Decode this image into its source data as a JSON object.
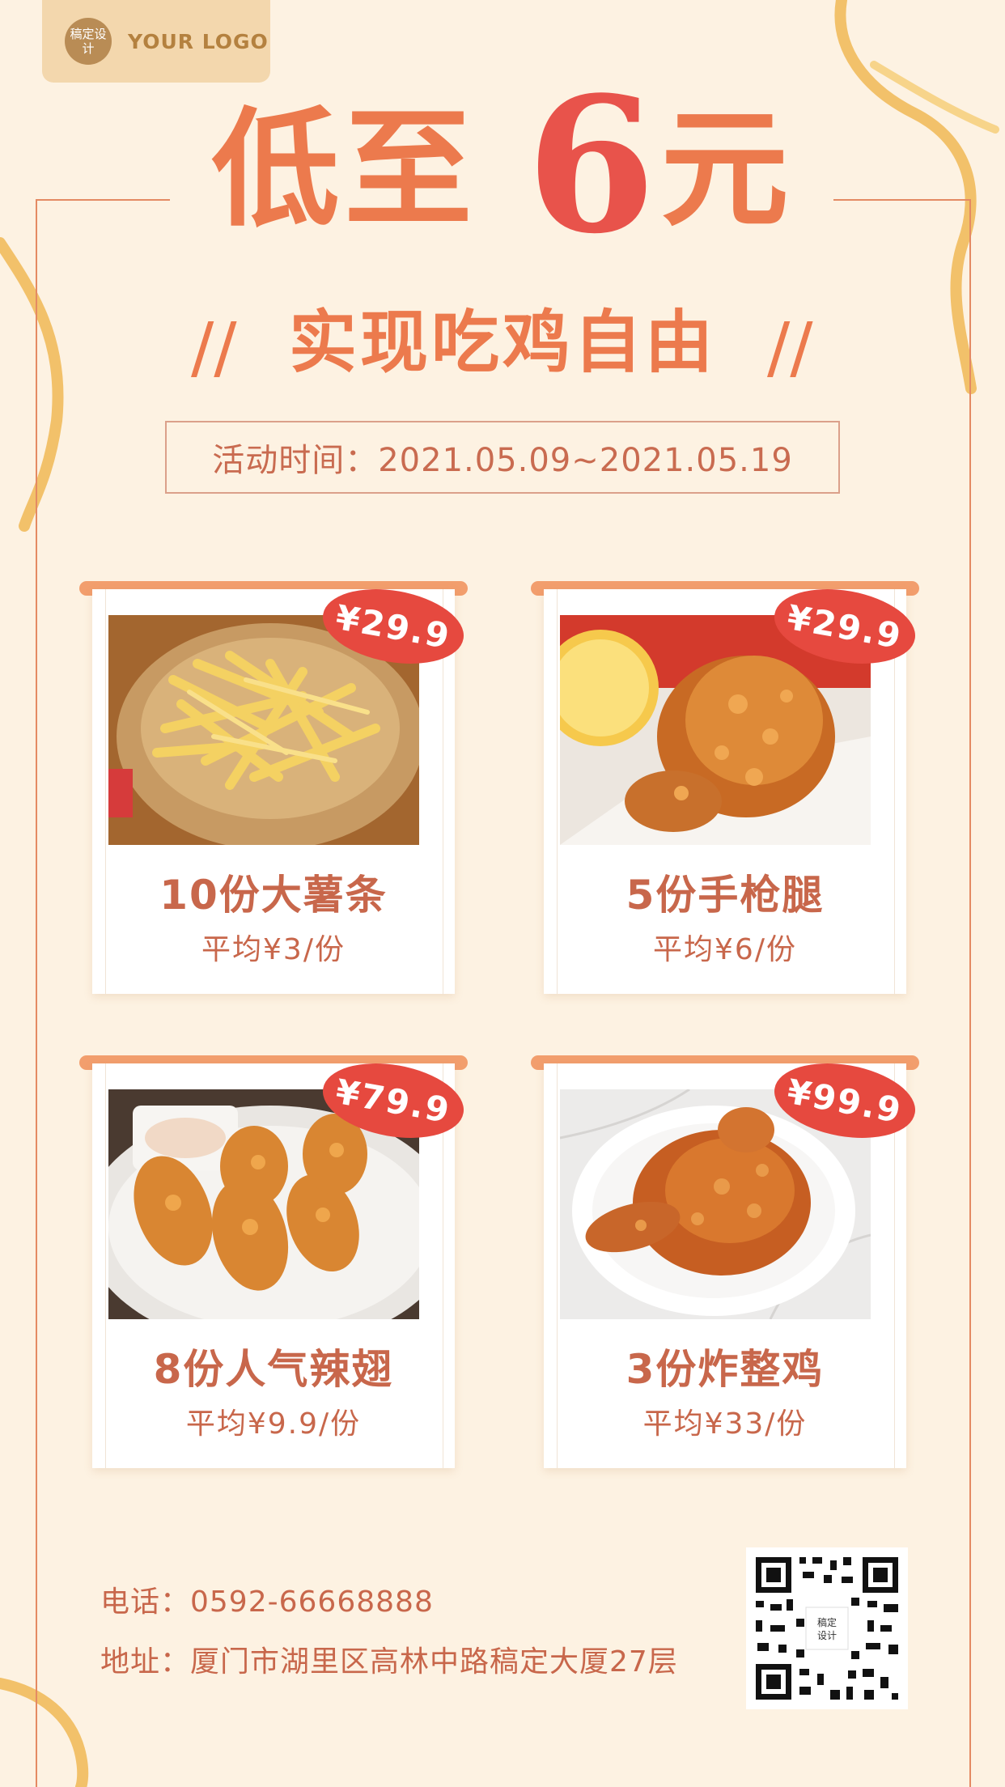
{
  "logo": {
    "seal_text": "稿定设计",
    "text": "YOUR LOGO"
  },
  "headline": {
    "prefix": "低至",
    "number": "6",
    "suffix": "元"
  },
  "subline": "实现吃鸡自由",
  "event_time": "活动时间：2021.05.09~2021.05.19",
  "products": [
    {
      "price": "¥29.9",
      "title": "10份大薯条",
      "average": "平均¥3/份",
      "photo": "french-fries"
    },
    {
      "price": "¥29.9",
      "title": "5份手枪腿",
      "average": "平均¥6/份",
      "photo": "fried-drumstick"
    },
    {
      "price": "¥79.9",
      "title": "8份人气辣翅",
      "average": "平均¥9.9/份",
      "photo": "spicy-wings"
    },
    {
      "price": "¥99.9",
      "title": "3份炸整鸡",
      "average": "平均¥33/份",
      "photo": "whole-fried-chicken"
    }
  ],
  "contact": {
    "phone": "电话：0592-66668888",
    "address": "地址：厦门市湖里区高林中路稿定大厦27层"
  },
  "qr_center_text": "稿定设计",
  "colors": {
    "background": "#fdf2e2",
    "accent": "#ec7a4d",
    "price_badge": "#e6493f",
    "text": "#c8674b"
  }
}
